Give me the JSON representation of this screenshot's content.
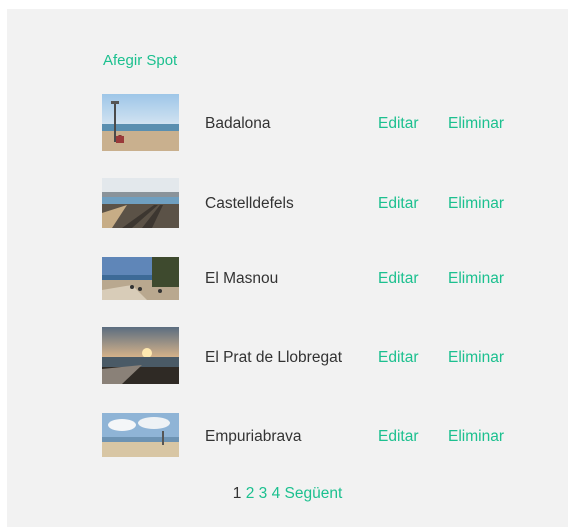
{
  "add_link": "Afegir Spot",
  "spots": [
    {
      "name": "Badalona",
      "edit": "Editar",
      "delete": "Eliminar"
    },
    {
      "name": "Castelldefels",
      "edit": "Editar",
      "delete": "Eliminar"
    },
    {
      "name": "El Masnou",
      "edit": "Editar",
      "delete": "Eliminar"
    },
    {
      "name": "El Prat de Llobregat",
      "edit": "Editar",
      "delete": "Eliminar"
    },
    {
      "name": "Empuriabrava",
      "edit": "Editar",
      "delete": "Eliminar"
    }
  ],
  "pagination": {
    "current": "1",
    "pages": [
      "2",
      "3",
      "4"
    ],
    "next": "Següent"
  },
  "colors": {
    "accent": "#1cc08f",
    "text": "#333333",
    "panel": "#f2f2f2"
  }
}
